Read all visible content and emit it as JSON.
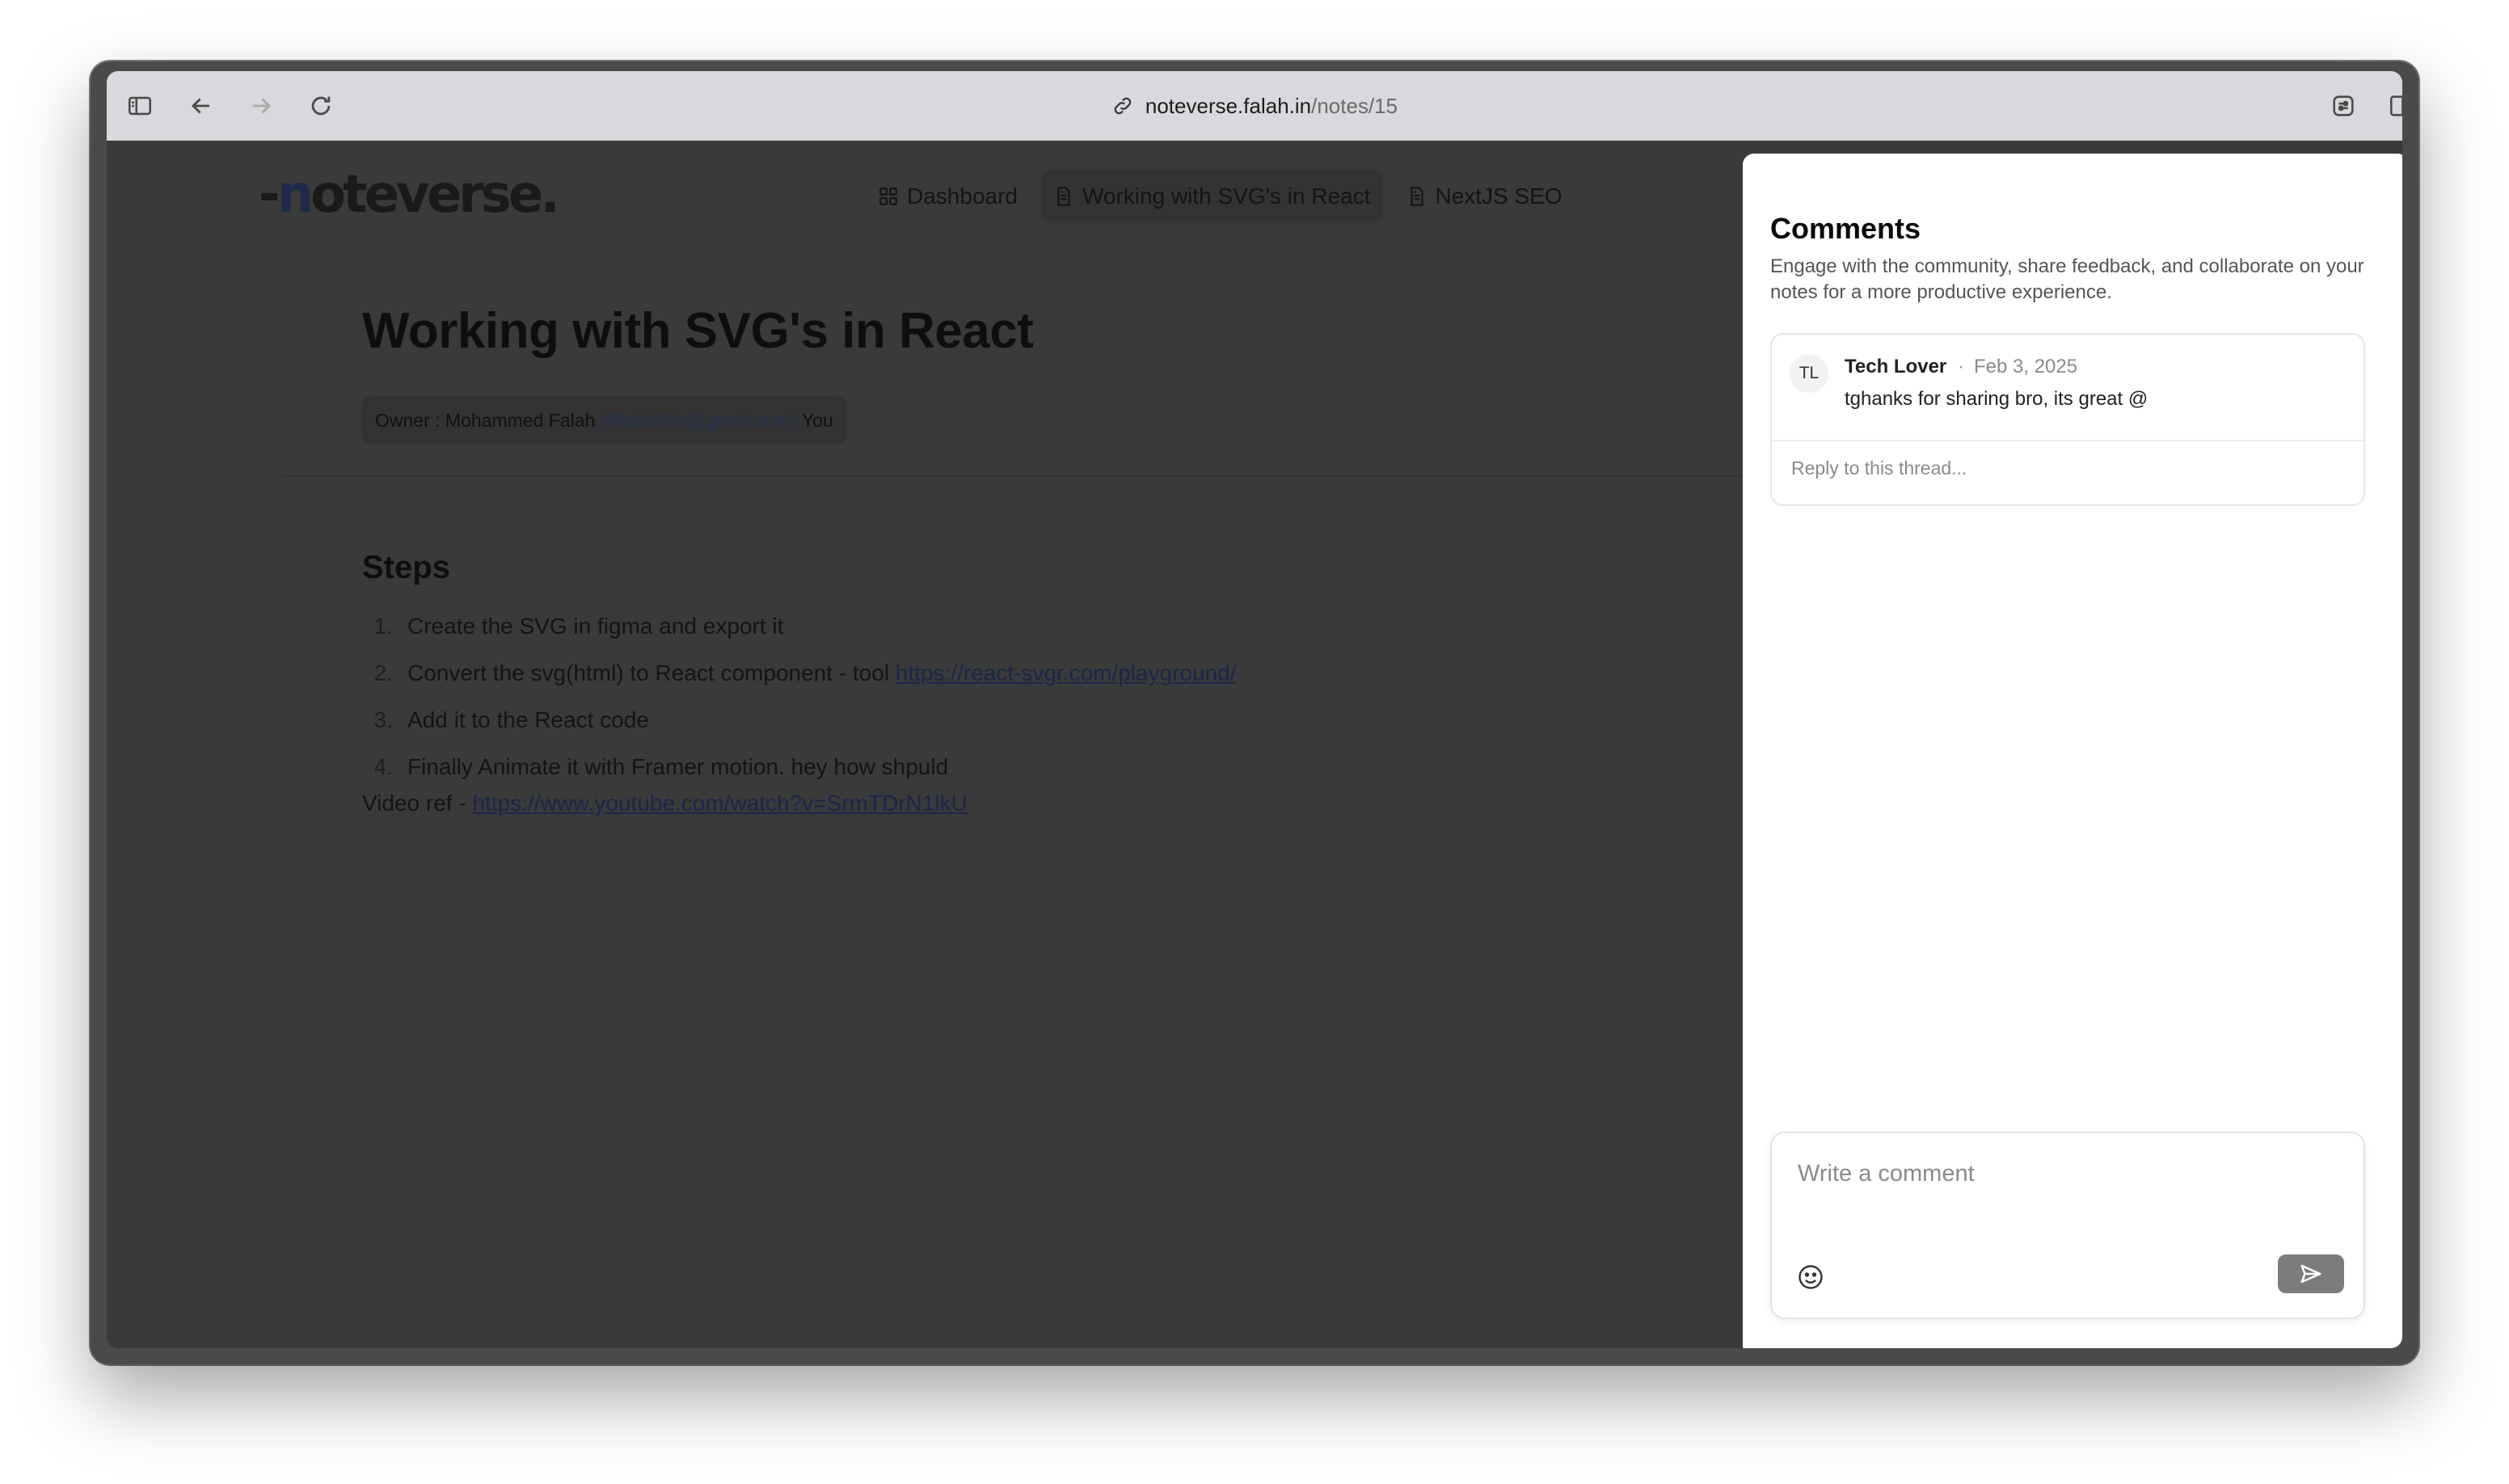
{
  "browser": {
    "url_host": "noteverse.falah.in",
    "url_path": "/notes/15"
  },
  "app": {
    "logo_dash": "-",
    "logo_n": "n",
    "logo_rest": "oteverse",
    "logo_dot": "."
  },
  "nav": {
    "items": [
      {
        "label": "Dashboard",
        "icon": "grid-icon"
      },
      {
        "label": "Working with SVG's in React",
        "icon": "document-icon"
      },
      {
        "label": "NextJS SEO",
        "icon": "document-icon"
      }
    ]
  },
  "note": {
    "title": "Working with SVG's in React",
    "owner_prefix": "Owner : Mohammed Falah",
    "owner_email": "(fffalahhhh@gmail.com)",
    "owner_suffix": "You",
    "section_heading": "Steps",
    "steps": [
      {
        "num": "1.",
        "text": "Create the SVG in figma and export it",
        "link": ""
      },
      {
        "num": "2.",
        "text": "Convert the svg(html) to React component - tool ",
        "link": "https://react-svgr.com/playground/"
      },
      {
        "num": "3.",
        "text": "Add it to the React code",
        "link": ""
      },
      {
        "num": "4.",
        "text": "Finally Animate it with Framer motion. hey how shpuld",
        "link": ""
      }
    ],
    "video_label": "Video ref - ",
    "video_link": "https://www.youtube.com/watch?v=SrmTDrN1lkU"
  },
  "comments": {
    "heading": "Comments",
    "subtitle": "Engage with the community, share feedback, and collaborate on your notes for a more productive experience.",
    "thread": {
      "avatar_initials": "TL",
      "author": "Tech Lover",
      "separator": "·",
      "date": "Feb 3, 2025",
      "text": "tghanks for sharing bro, its great @",
      "reply_placeholder": "Reply to this thread..."
    },
    "composer_placeholder": "Write a comment"
  }
}
